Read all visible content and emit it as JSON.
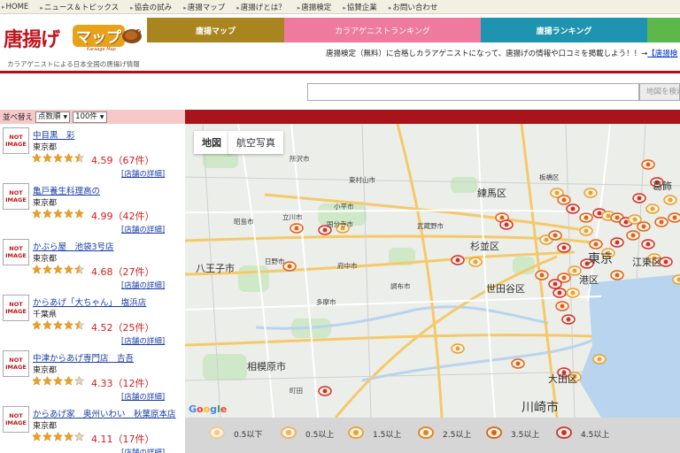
{
  "topnav": [
    "HOME",
    "ニュース＆トピックス",
    "協会の試み",
    "唐揚マップ",
    "唐揚げとは？",
    "唐揚検定",
    "協賛企業",
    "お問い合わせ"
  ],
  "logo": {
    "jp": "唐揚げ",
    "map": "マップ",
    "sub": "Karaage Map"
  },
  "tagline": "カラアゲニストによる日本全国の唐揚げ情報",
  "tabs": {
    "map": "唐揚マップ",
    "ranking_ag": "カラアゲニストランキング",
    "ranking_shop": "唐揚ランキング"
  },
  "notice": {
    "text": "唐揚検定（無料）に合格しカラアゲニストになって、唐揚げの情報や口コミを掲載しよう！！→",
    "link": "【唐揚検"
  },
  "search": {
    "placeholder": "",
    "button": "地図を検索"
  },
  "sort": {
    "label": "並べ替え",
    "order": "点数順",
    "count": "100件"
  },
  "no_image": [
    "NOT",
    "IMAGE"
  ],
  "shops": [
    {
      "name": "中目黒　彩",
      "pref": "東京都",
      "stars": 4.5,
      "score": "4.59（67件）",
      "detail": "[店舗の詳細]"
    },
    {
      "name": "亀戸養生料理高の",
      "pref": "東京都",
      "stars": 5,
      "score": "4.99（42件）",
      "detail": "[店舗の詳細]"
    },
    {
      "name": "かぶら屋　池袋3号店",
      "pref": "東京都",
      "stars": 4.5,
      "score": "4.68（27件）",
      "detail": "[店舗の詳細]"
    },
    {
      "name": "からあげ「大ちゃん」　塩浜店",
      "pref": "千葉県",
      "stars": 4.5,
      "score": "4.52（25件）",
      "detail": "[店舗の詳細]"
    },
    {
      "name": "中津からあげ専門店　吉吾",
      "pref": "東京都",
      "stars": 4,
      "score": "4.33（12件）",
      "detail": "[店舗の詳細]"
    },
    {
      "name": "からあげ家　奥州いわい　秋葉原本店",
      "pref": "東京都",
      "stars": 4,
      "score": "4.11（17件）",
      "detail": "[店舗の詳細]"
    }
  ],
  "map": {
    "type_map": "地図",
    "type_satellite": "航空写真",
    "labels": {
      "itabashi": "板橋区",
      "nerima": "練馬区",
      "suginami": "杉並区",
      "setagaya": "世田谷区",
      "ota": "大田区",
      "kawasaki": "川崎市",
      "hachioji": "八王子市",
      "sagamihara": "相模原市",
      "tokyo": "東京",
      "koto": "江東区",
      "minato": "港区",
      "katsushika": "葛飾",
      "tachikawa": "立川市",
      "fuchu": "府中市",
      "chofu": "調布市",
      "tama": "多摩市",
      "kodaira": "小平市",
      "kokubunji": "国分寺市",
      "hino": "日野市",
      "machida": "町田",
      "higashimurayama": "東村山市",
      "tokorozawa": "所沢市",
      "akishima": "昭島市",
      "musashino": "武蔵野市"
    },
    "google": "Google"
  },
  "legend": [
    "0.5以下",
    "0.5以上",
    "1.5以上",
    "2.5以上",
    "3.5以上",
    "4.5以上"
  ],
  "colors": {
    "brand_red": "#b30d12",
    "tab_gold": "#a8851e",
    "tab_pink": "#ef7aa0",
    "tab_blue": "#1f94b0",
    "sort_pink": "#f7c8c8",
    "link_blue": "#1a3fa8",
    "score_red": "#d02020"
  }
}
